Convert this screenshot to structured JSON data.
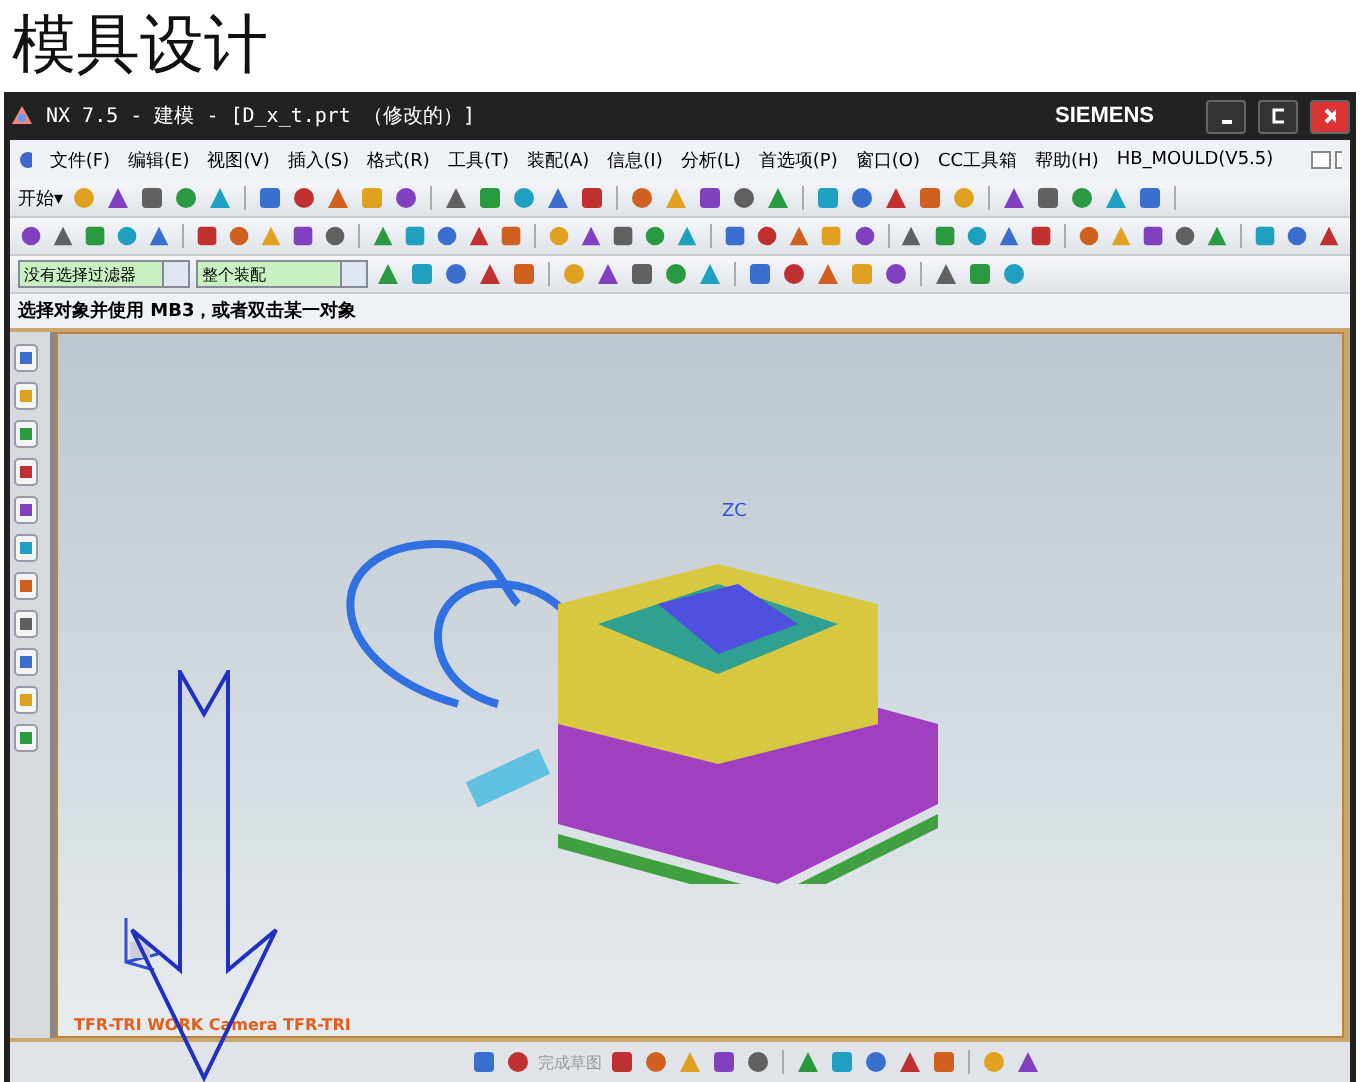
{
  "heading": "模具设计",
  "window": {
    "title": "NX 7.5 - 建模 - [D_x_t.prt （修改的）]",
    "brand": "SIEMENS"
  },
  "menu": [
    "文件(F)",
    "编辑(E)",
    "视图(V)",
    "插入(S)",
    "格式(R)",
    "工具(T)",
    "装配(A)",
    "信息(I)",
    "分析(L)",
    "首选项(P)",
    "窗口(O)",
    "CC工具箱",
    "帮助(H)",
    "HB_MOULD(V5.5)"
  ],
  "start_button": "开始▾",
  "filters": [
    {
      "value": "没有选择过滤器"
    },
    {
      "value": "整个装配"
    }
  ],
  "prompt": "选择对象并使用 MB3，或者双击某一对象",
  "viewport": {
    "axis_label": "ZC",
    "view_label": "TFR-TRI WORK Camera TFR-TRI"
  },
  "sketch_bar": {
    "finish_sketch": "完成草图",
    "disabled": true
  }
}
